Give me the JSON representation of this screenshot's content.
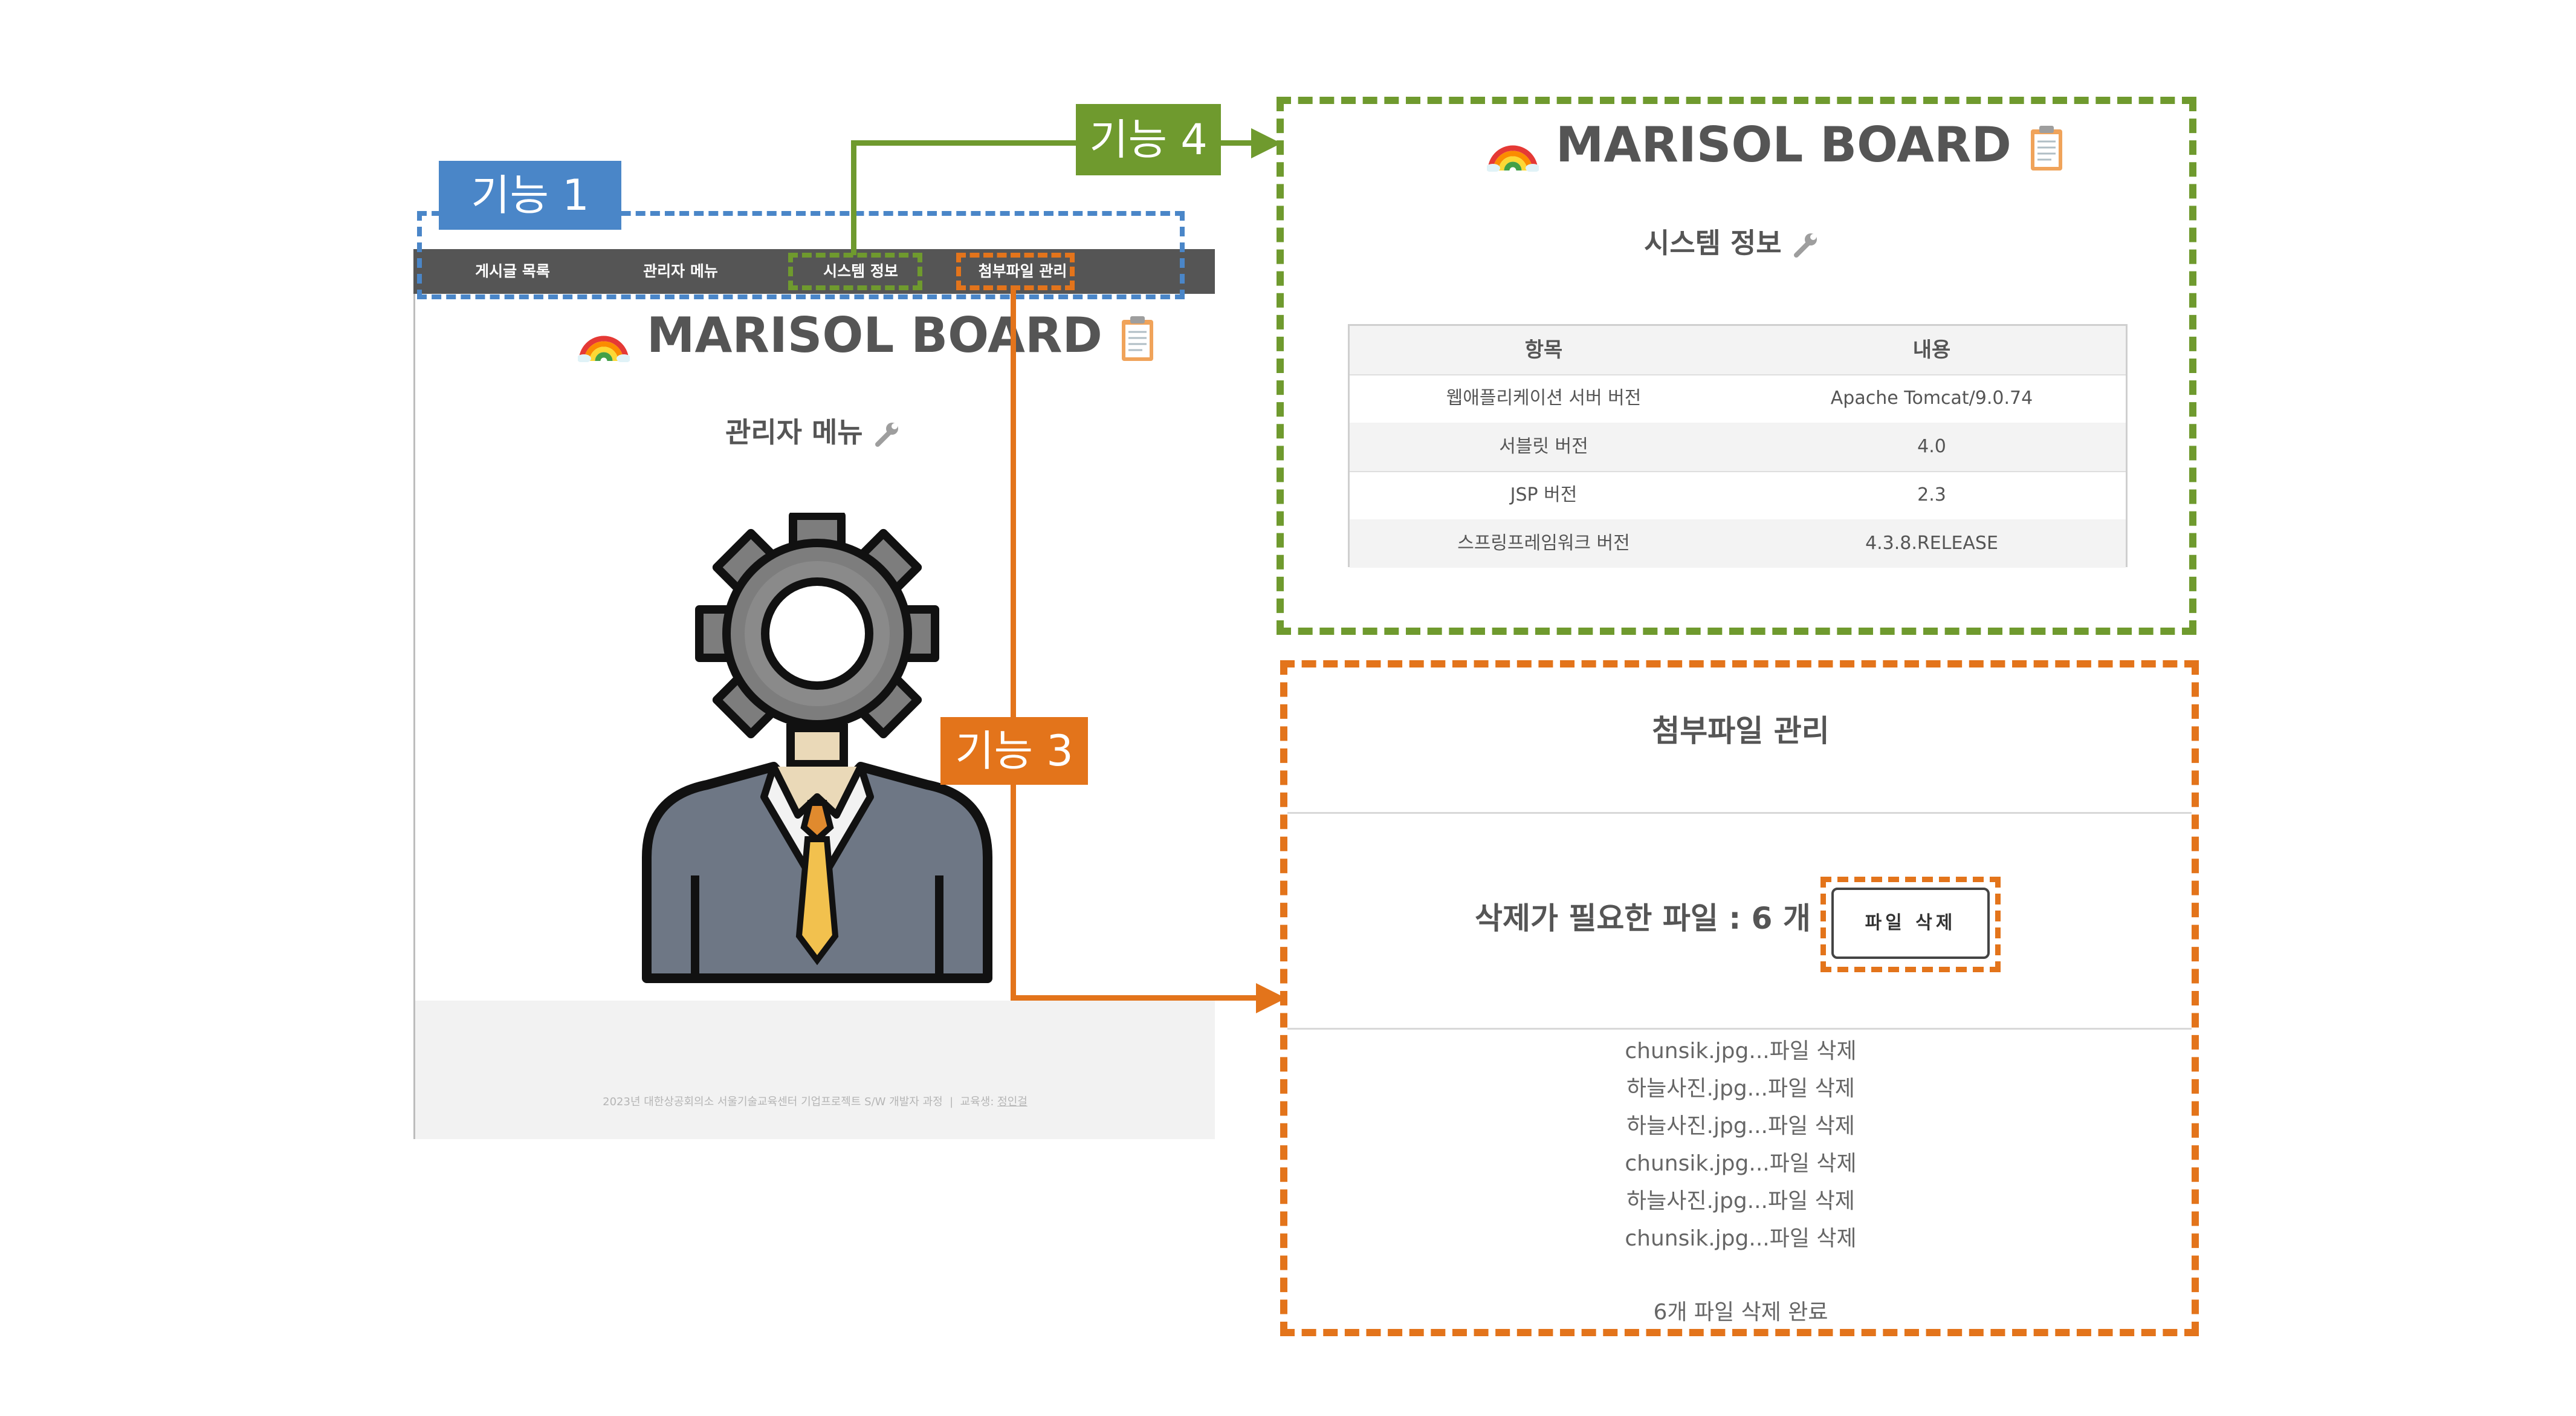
{
  "labels": {
    "feature1": "기능 1",
    "feature3": "기능 3",
    "feature4": "기능 4"
  },
  "colors": {
    "blue": "#4a86c8",
    "green": "#6f9a2e",
    "orange": "#e3741b",
    "nav_bg": "#555555"
  },
  "nav": {
    "items": [
      "게시글 목록",
      "관리자 메뉴",
      "시스템 정보",
      "첨부파일 관리"
    ]
  },
  "brand": {
    "title": "MARISOL BOARD",
    "icons": [
      "rainbow-icon",
      "clipboard-icon"
    ]
  },
  "admin_page": {
    "heading": "관리자 메뉴",
    "heading_icon": "wrench-icon",
    "illustration": "admin-gear-person-icon",
    "footer_text": "2023년 대한상공회의소 서울기술교육센터 기업프로젝트 S/W 개발자 과정",
    "footer_separator": "|",
    "footer_label": "교육생:",
    "footer_name": "정인걸"
  },
  "system_info": {
    "heading": "시스템 정보",
    "heading_icon": "wrench-icon",
    "table": {
      "headers": [
        "항목",
        "내용"
      ],
      "rows": [
        [
          "웹애플리케이션 서버 버전",
          "Apache Tomcat/9.0.74"
        ],
        [
          "서블릿 버전",
          "4.0"
        ],
        [
          "JSP 버전",
          "2.3"
        ],
        [
          "스프링프레임워크 버전",
          "4.3.8.RELEASE"
        ]
      ]
    }
  },
  "attachments": {
    "heading": "첨부파일 관리",
    "needed_label": "삭제가 필요한 파일 : 6 개",
    "delete_button": "파일 삭제",
    "log": [
      "chunsik.jpg...파일 삭제",
      "하늘사진.jpg...파일 삭제",
      "하늘사진.jpg...파일 삭제",
      "chunsik.jpg...파일 삭제",
      "하늘사진.jpg...파일 삭제",
      "chunsik.jpg...파일 삭제"
    ],
    "summary": "6개 파일 삭제 완료"
  }
}
